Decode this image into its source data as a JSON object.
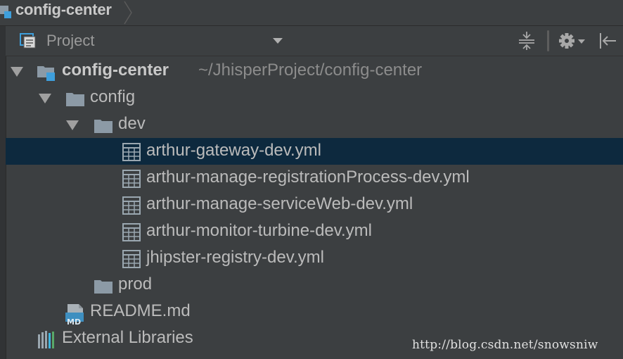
{
  "breadcrumb": {
    "label": "config-center"
  },
  "panel": {
    "title": "Project",
    "icons": [
      "project-icon",
      "dropdown-arrow-icon",
      "collapse-all-icon",
      "gear-icon",
      "hide-panel-icon"
    ]
  },
  "tree": {
    "root": {
      "label": "config-center",
      "path": "~/JhisperProject/config-center"
    },
    "config": {
      "label": "config"
    },
    "dev": {
      "label": "dev"
    },
    "files": [
      {
        "label": "arthur-gateway-dev.yml",
        "selected": true
      },
      {
        "label": "arthur-manage-registrationProcess-dev.yml"
      },
      {
        "label": "arthur-manage-serviceWeb-dev.yml"
      },
      {
        "label": "arthur-monitor-turbine-dev.yml"
      },
      {
        "label": "jhipster-registry-dev.yml"
      }
    ],
    "prod": {
      "label": "prod"
    },
    "readme": {
      "label": "README.md",
      "badge": "MD"
    },
    "external": {
      "label": "External Libraries"
    }
  },
  "colors": {
    "background": "#3c3f41",
    "selection": "#0d293e",
    "folder": "#8c9aa6",
    "module_accent": "#3e9fdc"
  },
  "watermark": "http://blog.csdn.net/snowsniw"
}
